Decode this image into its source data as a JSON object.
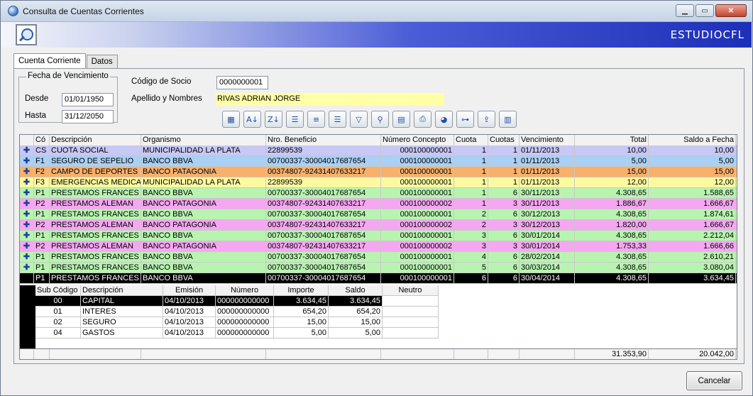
{
  "window": {
    "title": "Consulta de Cuentas Corrientes",
    "brand": "ESTUDIOCFL",
    "minimize": "▁",
    "maximize": "▭",
    "close": "✕"
  },
  "tabs": [
    {
      "label": "Cuenta Corriente"
    },
    {
      "label": "Datos"
    }
  ],
  "filters": {
    "legend": "Fecha de Vencimiento",
    "desde_label": "Desde",
    "desde": "01/01/1950",
    "hasta_label": "Hasta",
    "hasta": "31/12/2050",
    "codigo_label": "Código de Socio",
    "codigo": "0000000001",
    "apellido_label": "Apellido y Nombres",
    "apellido": "RIVAS ADRIAN JORGE"
  },
  "toolbar": [
    "calculator-icon",
    "sort-ascending-icon",
    "sort-descending-icon",
    "align-left-icon",
    "align-center-icon",
    "align-right-icon",
    "filter-icon",
    "find-icon",
    "excel-export-icon",
    "print-icon",
    "color-palette-icon",
    "tree-expand-icon",
    "export-icon",
    "chart-icon"
  ],
  "columns": [
    "Có",
    "Descripción",
    "Organismo",
    "Nro. Beneficio",
    "Número Concepto",
    "Cuota",
    "Cuotas",
    "Vencimiento",
    "Total",
    "Saldo a Fecha"
  ],
  "rows": [
    {
      "cod": "CS",
      "desc": "CUOTA SOCIAL",
      "org": "MUNICIPALIDAD LA PLATA",
      "benef": "22899539",
      "concepto": "000100000001",
      "cuota": "1",
      "cuotas": "1",
      "venc": "01/11/2013",
      "total": "10,00",
      "saldo": "10,00",
      "color": "#c8c8f4"
    },
    {
      "cod": "F1",
      "desc": "SEGURO DE SEPELIO",
      "org": "BANCO BBVA",
      "benef": "00700337-30004017687654",
      "concepto": "000100000001",
      "cuota": "1",
      "cuotas": "1",
      "venc": "01/11/2013",
      "total": "5,00",
      "saldo": "5,00",
      "color": "#a9d0f5"
    },
    {
      "cod": "F2",
      "desc": "CAMPO DE DEPORTES",
      "org": "BANCO PATAGONIA",
      "benef": "00374807-92431407633217",
      "concepto": "000100000001",
      "cuota": "1",
      "cuotas": "1",
      "venc": "01/11/2013",
      "total": "15,00",
      "saldo": "15,00",
      "color": "#f8b06a"
    },
    {
      "cod": "F3",
      "desc": "EMERGENCIAS MEDICAS",
      "org": "MUNICIPALIDAD LA PLATA",
      "benef": "22899539",
      "concepto": "000100000001",
      "cuota": "1",
      "cuotas": "1",
      "venc": "01/11/2013",
      "total": "12,00",
      "saldo": "12,00",
      "color": "#fdf9a0"
    },
    {
      "cod": "P1",
      "desc": "PRESTAMOS FRANCES",
      "org": "BANCO BBVA",
      "benef": "00700337-30004017687654",
      "concepto": "000100000001",
      "cuota": "1",
      "cuotas": "6",
      "venc": "30/11/2013",
      "total": "4.308,65",
      "saldo": "1.588,65",
      "color": "#b8f4b0"
    },
    {
      "cod": "P2",
      "desc": "PRESTAMOS ALEMAN",
      "org": "BANCO PATAGONIA",
      "benef": "00374807-92431407633217",
      "concepto": "000100000002",
      "cuota": "1",
      "cuotas": "3",
      "venc": "30/11/2013",
      "total": "1.886,67",
      "saldo": "1.666,67",
      "color": "#f5a7f2"
    },
    {
      "cod": "P1",
      "desc": "PRESTAMOS FRANCES",
      "org": "BANCO BBVA",
      "benef": "00700337-30004017687654",
      "concepto": "000100000001",
      "cuota": "2",
      "cuotas": "6",
      "venc": "30/12/2013",
      "total": "4.308,65",
      "saldo": "1.874,61",
      "color": "#b8f4b0"
    },
    {
      "cod": "P2",
      "desc": "PRESTAMOS ALEMAN",
      "org": "BANCO PATAGONIA",
      "benef": "00374807-92431407633217",
      "concepto": "000100000002",
      "cuota": "2",
      "cuotas": "3",
      "venc": "30/12/2013",
      "total": "1.820,00",
      "saldo": "1.666,67",
      "color": "#f5a7f2"
    },
    {
      "cod": "P1",
      "desc": "PRESTAMOS FRANCES",
      "org": "BANCO BBVA",
      "benef": "00700337-30004017687654",
      "concepto": "000100000001",
      "cuota": "3",
      "cuotas": "6",
      "venc": "30/01/2014",
      "total": "4.308,65",
      "saldo": "2.212,04",
      "color": "#b8f4b0"
    },
    {
      "cod": "P2",
      "desc": "PRESTAMOS ALEMAN",
      "org": "BANCO PATAGONIA",
      "benef": "00374807-92431407633217",
      "concepto": "000100000002",
      "cuota": "3",
      "cuotas": "3",
      "venc": "30/01/2014",
      "total": "1.753,33",
      "saldo": "1.666,66",
      "color": "#f5a7f2"
    },
    {
      "cod": "P1",
      "desc": "PRESTAMOS FRANCES",
      "org": "BANCO BBVA",
      "benef": "00700337-30004017687654",
      "concepto": "000100000001",
      "cuota": "4",
      "cuotas": "6",
      "venc": "28/02/2014",
      "total": "4.308,65",
      "saldo": "2.610,21",
      "color": "#b8f4b0"
    },
    {
      "cod": "P1",
      "desc": "PRESTAMOS FRANCES",
      "org": "BANCO BBVA",
      "benef": "00700337-30004017687654",
      "concepto": "000100000001",
      "cuota": "5",
      "cuotas": "6",
      "venc": "30/03/2014",
      "total": "4.308,65",
      "saldo": "3.080,04",
      "color": "#b8f4b0"
    },
    {
      "cod": "P1",
      "desc": "PRESTAMOS FRANCES",
      "org": "BANCO BBVA",
      "benef": "00700337-30004017687654",
      "concepto": "000100000001",
      "cuota": "6",
      "cuotas": "6",
      "venc": "30/04/2014",
      "total": "4.308,65",
      "saldo": "3.634,45",
      "color": "#000000",
      "selected": true
    }
  ],
  "expand_marker": "✚",
  "detail_columns": [
    "Sub Código",
    "Descripción",
    "Emisión",
    "Número",
    "Importe",
    "Saldo",
    "Neutro"
  ],
  "detail_rows": [
    {
      "sub": "00",
      "desc": "CAPITAL",
      "emision": "04/10/2013",
      "numero": "000000000000",
      "importe": "3.634,45",
      "saldo": "3.634,45",
      "neutro": "",
      "selected": true
    },
    {
      "sub": "01",
      "desc": "INTERES",
      "emision": "04/10/2013",
      "numero": "000000000000",
      "importe": "654,20",
      "saldo": "654,20",
      "neutro": ""
    },
    {
      "sub": "02",
      "desc": "SEGURO",
      "emision": "04/10/2013",
      "numero": "000000000000",
      "importe": "15,00",
      "saldo": "15,00",
      "neutro": ""
    },
    {
      "sub": "04",
      "desc": "GASTOS",
      "emision": "04/10/2013",
      "numero": "000000000000",
      "importe": "5,00",
      "saldo": "5,00",
      "neutro": ""
    }
  ],
  "totals": {
    "total": "31.353,90",
    "saldo": "20.042,00"
  },
  "cancel_label": "Cancelar"
}
